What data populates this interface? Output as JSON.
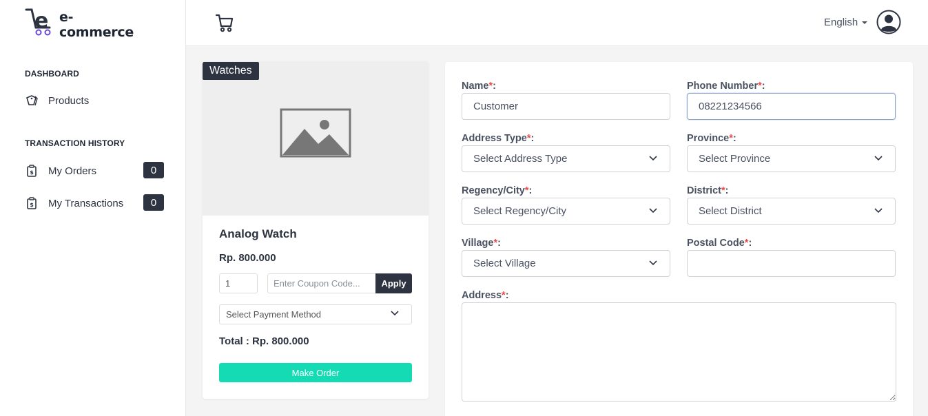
{
  "app": {
    "logo_text": "e-commerce"
  },
  "sidebar": {
    "sections": [
      {
        "title": "DASHBOARD"
      },
      {
        "title": "TRANSACTION HISTORY"
      }
    ],
    "items": [
      {
        "label": "Products",
        "icon": "tags-icon"
      },
      {
        "label": "My Orders",
        "icon": "receipt-icon",
        "badge": "0"
      },
      {
        "label": "My Transactions",
        "icon": "receipt-icon",
        "badge": "0"
      }
    ]
  },
  "header": {
    "language": "English",
    "cart_icon": "cart-icon",
    "user_icon": "user-circle-icon"
  },
  "product": {
    "category": "Watches",
    "name": "Analog Watch",
    "price": "Rp. 800.000",
    "quantity": "1",
    "coupon_placeholder": "Enter Coupon Code...",
    "apply_label": "Apply",
    "payment_placeholder": "Select Payment Method",
    "total": "Total : Rp. 800.000",
    "order_label": "Make Order"
  },
  "form": {
    "name_label": "Name",
    "name_value": "Customer",
    "phone_label": "Phone Number",
    "phone_value": "08221234566",
    "address_type_label": "Address Type",
    "address_type_placeholder": "Select Address Type",
    "province_label": "Province",
    "province_placeholder": "Select Province",
    "regency_label": "Regency/City",
    "regency_placeholder": "Select Regency/City",
    "district_label": "District",
    "district_placeholder": "Select District",
    "village_label": "Village",
    "village_placeholder": "Select Village",
    "postal_label": "Postal Code",
    "postal_value": "",
    "address_label": "Address",
    "required_mark": "*",
    "colon": ":"
  },
  "colors": {
    "accent": "#15dbb5",
    "dark": "#2d3340",
    "required": "#e84a4a"
  }
}
